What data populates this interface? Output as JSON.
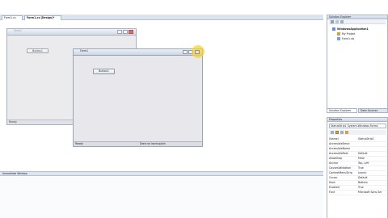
{
  "document": {
    "tabs": [
      "Form1.cs",
      "Form1.cs [Design]*"
    ]
  },
  "designer": {
    "back_form": {
      "title": "Form1",
      "button_label": "Button1",
      "status_text": "Ready"
    },
    "front_form": {
      "title": "Form1",
      "button_label": "Button1",
      "status_left": "Ready",
      "status_right": "Done on backup/ain"
    }
  },
  "output_panel": {
    "title": "Immediate Window"
  },
  "solution_explorer": {
    "title": "Solution Explorer",
    "items": [
      "WindowsApplication1",
      "My Project",
      "Form1.vb"
    ],
    "tabs": [
      "Solution Explorer",
      "Data Sources"
    ]
  },
  "properties": {
    "title": "Properties",
    "object_selector": "StatusStrip1  System.Windows.Forms",
    "rows": [
      {
        "name": "(Name)",
        "value": "StatusStrip1"
      },
      {
        "name": "AccessibleDescr",
        "value": ""
      },
      {
        "name": "AccessibleName",
        "value": ""
      },
      {
        "name": "AccessibleRole",
        "value": "Default"
      },
      {
        "name": "AllowDrop",
        "value": "False"
      },
      {
        "name": "Anchor",
        "value": "Top, Left"
      },
      {
        "name": "CausesValidation",
        "value": "True"
      },
      {
        "name": "ContextMenuStrip",
        "value": "(none)"
      },
      {
        "name": "Cursor",
        "value": "Default"
      },
      {
        "name": "Dock",
        "value": "Bottom"
      },
      {
        "name": "Enabled",
        "value": "True"
      },
      {
        "name": "Font",
        "value": "Microsoft Sans Ser"
      }
    ]
  },
  "colors": {
    "highlight": "#f5d43a",
    "selection": "#3f68b8"
  }
}
